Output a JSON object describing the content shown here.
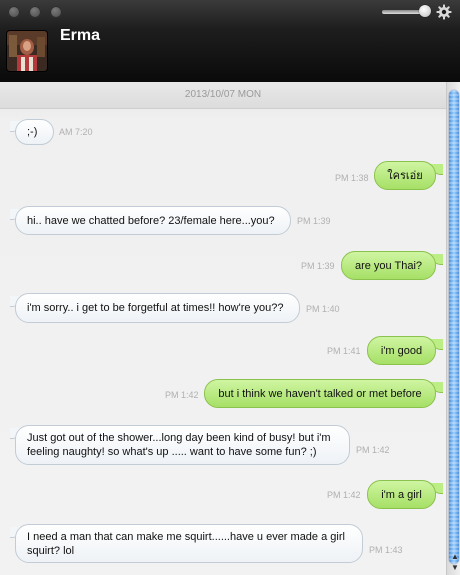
{
  "header": {
    "contact_name": "Erma",
    "avatar_icon": "contact-avatar-photo",
    "settings_icon": "gear-icon",
    "volume_level": 0.9
  },
  "date_separator": "2013/10/07 MON",
  "messages": [
    {
      "direction": "in",
      "text": ";-)",
      "time": "AM 7:20"
    },
    {
      "direction": "out",
      "text": "ใครเอ่ย",
      "time": "PM 1:38"
    },
    {
      "direction": "in",
      "text": "hi.. have we chatted before? 23/female here...you?",
      "time": "PM 1:39"
    },
    {
      "direction": "out",
      "text": "are you Thai?",
      "time": "PM 1:39"
    },
    {
      "direction": "in",
      "text": "i'm sorry.. i get to be forgetful at times!! how're you??",
      "time": "PM 1:40"
    },
    {
      "direction": "out",
      "text": "i'm good",
      "time": "PM 1:41"
    },
    {
      "direction": "out",
      "text": "but i think we haven't talked or met before",
      "time": "PM 1:42"
    },
    {
      "direction": "in",
      "text": "Just got out of the shower...long day been kind of busy! but i'm feeling naughty! so what's up ..... want to have some fun? ;)",
      "time": "PM 1:42"
    },
    {
      "direction": "out",
      "text": "i'm a girl",
      "time": "PM 1:42"
    },
    {
      "direction": "in",
      "text": "I need a man that can make me squirt......have u ever made a girl squirt? lol",
      "time": "PM 1:43"
    }
  ],
  "colors": {
    "header_bg": "#111111",
    "incoming_bubble": "#ffffff",
    "outgoing_bubble": "#b5ea7a",
    "scrollbar_thumb": "#5aa0ea"
  }
}
